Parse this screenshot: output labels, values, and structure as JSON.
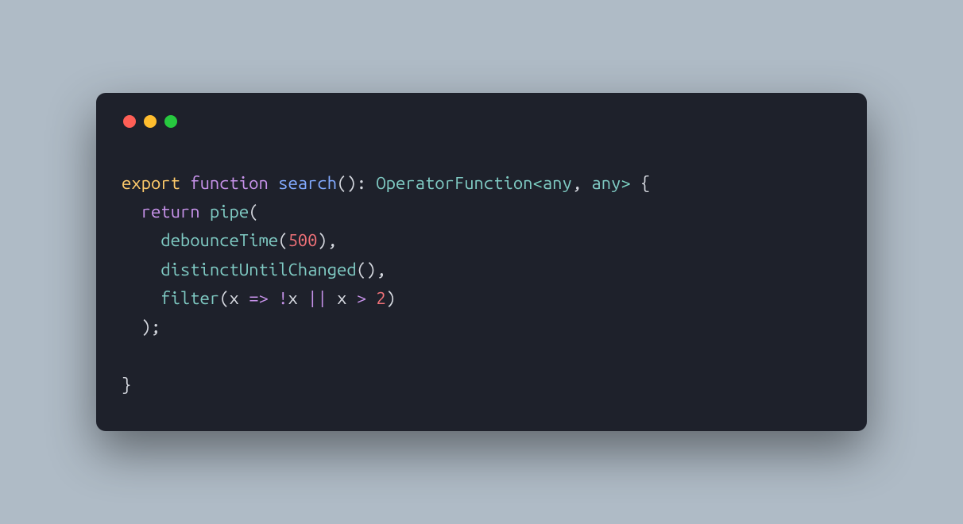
{
  "code": {
    "line1": {
      "export": "export",
      "function": "function",
      "name": "search",
      "parens": "():",
      "space": " ",
      "type": "OperatorFunction",
      "lt": "<",
      "any1": "any",
      "comma": ", ",
      "any2": "any",
      "gt": ">",
      "brace": " {"
    },
    "line2": {
      "indent": "  ",
      "return": "return",
      "space": " ",
      "pipe": "pipe",
      "paren": "("
    },
    "line3": {
      "indent": "    ",
      "fn": "debounceTime",
      "paren1": "(",
      "num": "500",
      "paren2": "),"
    },
    "line4": {
      "indent": "    ",
      "fn": "distinctUntilChanged",
      "parens": "(),"
    },
    "line5": {
      "indent": "    ",
      "fn": "filter",
      "paren1": "(",
      "x1": "x",
      "space1": " ",
      "arrow": "=>",
      "space2": " ",
      "not": "!",
      "x2": "x",
      "space3": " ",
      "or": "||",
      "space4": " ",
      "x3": "x",
      "space5": " ",
      "gt": ">",
      "space6": " ",
      "two": "2",
      "paren2": ")"
    },
    "line6": {
      "indent": "  ",
      "close": ");"
    },
    "line7": {
      "blank": ""
    },
    "line8": {
      "brace": "}"
    }
  }
}
